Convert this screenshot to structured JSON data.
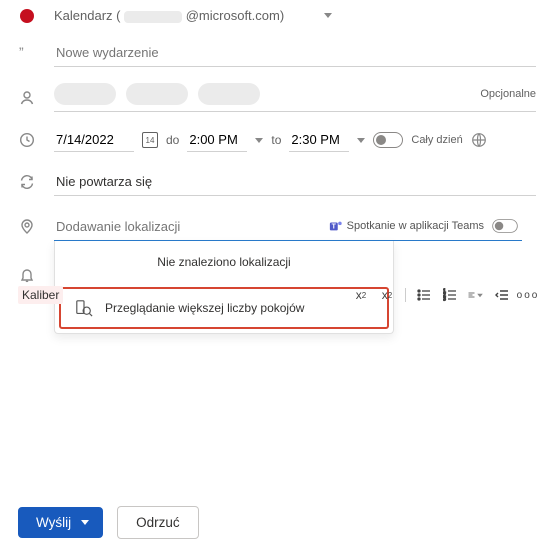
{
  "calendar": {
    "label": "Kalendarz (",
    "email_suffix": "@microsoft.com)"
  },
  "title": {
    "placeholder": "Nowe wydarzenie"
  },
  "attendees": {
    "optional_label": "Opcjonalne"
  },
  "datetime": {
    "date": "7/14/2022",
    "date_num": "14",
    "do_label": "do",
    "to_label": "to",
    "start_time": "2:00 PM",
    "end_time": "2:30 PM",
    "allday_label": "Cały dzień"
  },
  "recurrence": {
    "label": "Nie powtarza się"
  },
  "location": {
    "placeholder": "Dodawanie lokalizacji",
    "teams_label": "Spotkanie w aplikacji Teams",
    "no_results": "Nie znaleziono lokalizacji",
    "browse_more": "Przeglądanie większej liczby pokojów"
  },
  "editor": {
    "font_sample": "Kaliber",
    "sup_label": "x",
    "sub_label": "x"
  },
  "footer": {
    "send": "Wyślij",
    "discard": "Odrzuć"
  }
}
